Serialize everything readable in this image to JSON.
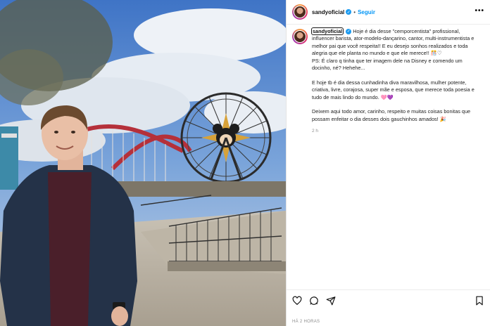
{
  "post": {
    "username": "sandyoficial",
    "follow_label": "Seguir",
    "separator": "•",
    "more_label": "•••",
    "verified_icon": "check-icon",
    "caption": {
      "paragraph1": "Hoje é dia desse \"cemporcentista\" profissional, influencer barista, ator-modelo-dançarino, cantor, multi-instrumentista e melhor pai que você respeita!! E eu desejo sonhos realizados e toda alegria que ele planta no mundo e que ele merece!! 🎊♡",
      "paragraph1b": "PS: É claro q tinha que ter imagem dele na Disney e comendo um docinho, né? Hehehe...",
      "paragraph2": "E hoje tb é dia dessa cunhadinha diva maravilhosa, mulher potente, criativa, livre, corajosa, super mãe e esposa, que merece toda poesia e tudo de mais lindo do mundo. 🩷💜",
      "paragraph3": "Deixem aqui todo amor, carinho, respeito e muitas coisas bonitas que possam enfeitar o dia desses dois gauchinhos amados! 🎉"
    },
    "caption_time": "2 h",
    "posted_ago": "HÁ 2 HORAS"
  },
  "icons": {
    "like": "heart-icon",
    "comment": "comment-icon",
    "share": "send-icon",
    "save": "bookmark-icon"
  }
}
